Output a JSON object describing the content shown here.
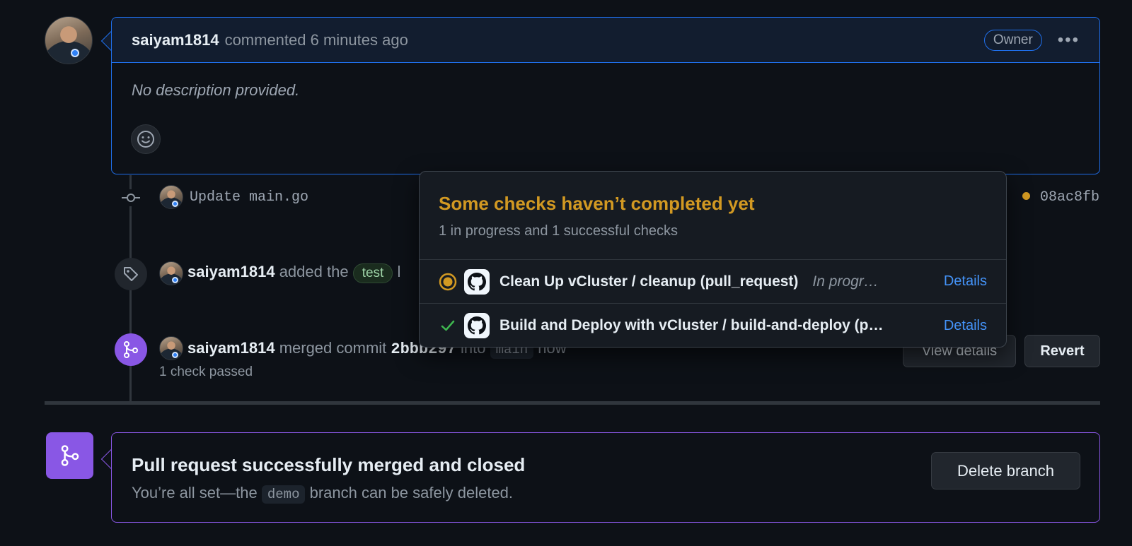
{
  "comment": {
    "author": "saiyam1814",
    "action": "commented 6 minutes ago",
    "role_badge": "Owner",
    "menu_label": "•••",
    "body": "No description provided."
  },
  "timeline": {
    "commit": {
      "message": "Update main.go",
      "sha": "08ac8fb",
      "status_color": "#d29922"
    },
    "label_event": {
      "author": "saiyam1814",
      "action": "added the",
      "label": "test",
      "trailing": "l"
    },
    "merge_event": {
      "author": "saiyam1814",
      "action": "merged commit",
      "commit": "2bbb297",
      "into": "into",
      "branch": "main",
      "time": "now",
      "checks": "1 check passed",
      "view_details_label": "View details",
      "revert_label": "Revert"
    }
  },
  "checks_popover": {
    "title": "Some checks haven’t completed yet",
    "subtitle": "1 in progress and 1 successful checks",
    "checks": [
      {
        "name": "Clean Up vCluster / cleanup (pull_request)",
        "status": "In progress",
        "state": "in-progress",
        "details_label": "Details"
      },
      {
        "name": "Build and Deploy with vCluster / build-and-deploy (pull_request)",
        "status": "",
        "state": "success",
        "details_label": "Details"
      }
    ]
  },
  "merged_panel": {
    "title": "Pull request successfully merged and closed",
    "text_before": "You’re all set—the",
    "branch": "demo",
    "text_after": "branch can be safely deleted.",
    "delete_label": "Delete branch"
  },
  "colors": {
    "accent_blue": "#1f6feb",
    "merged_purple": "#8957e5",
    "warning_yellow": "#d29922",
    "success_green": "#3fb950",
    "link_blue": "#4493f8"
  }
}
